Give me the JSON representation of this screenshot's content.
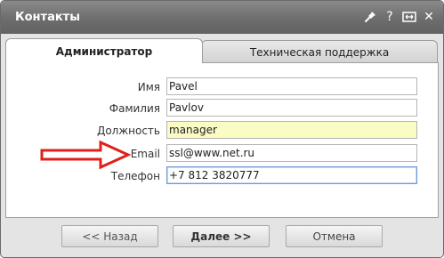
{
  "window": {
    "title": "Контакты",
    "icons": [
      "pin-icon",
      "help-icon",
      "resize-icon",
      "close-icon"
    ],
    "help_glyph": "?",
    "close_glyph": "✕"
  },
  "tabs": [
    {
      "label": "Администратор",
      "active": true
    },
    {
      "label": "Техническая поддержка",
      "active": false
    }
  ],
  "form": {
    "fields": [
      {
        "label": "Имя",
        "value": "Pavel"
      },
      {
        "label": "Фамилия",
        "value": "Pavlov"
      },
      {
        "label": "Должность",
        "value": "manager",
        "highlight": "#fbfbc4"
      },
      {
        "label": "Email",
        "value": "ssl@www.net.ru"
      },
      {
        "label": "Телефон",
        "value": "+7 812 3820777",
        "focused": true
      }
    ]
  },
  "buttons": {
    "back": "<< Назад",
    "next": "Далее >>",
    "cancel": "Отмена"
  },
  "colors": {
    "arrow": "#e0201b",
    "titlebar": "#6d6d6d",
    "highlight_field": "#fbfbc4"
  }
}
